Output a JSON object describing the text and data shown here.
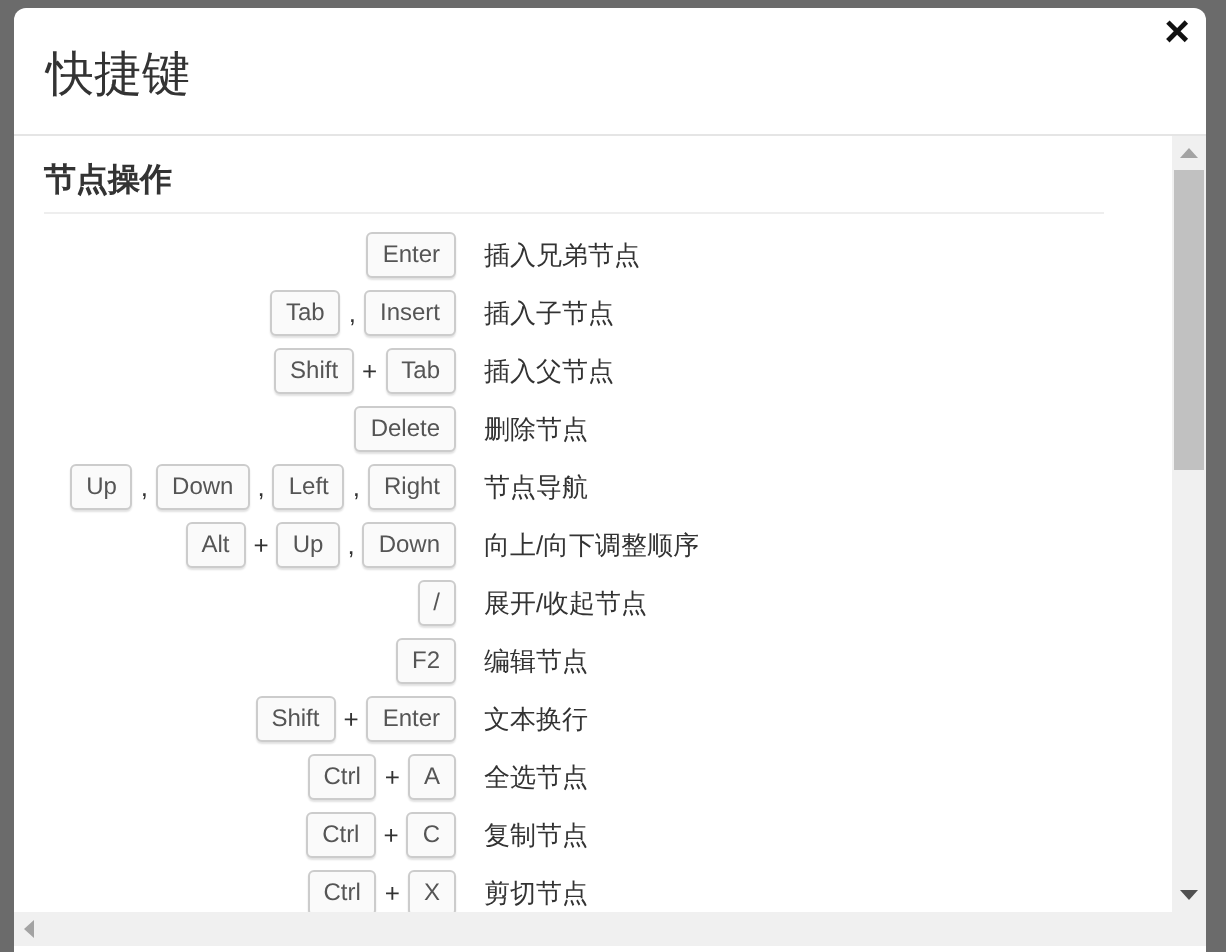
{
  "dialog": {
    "title": "快捷键",
    "close": "×"
  },
  "section": {
    "title": "节点操作"
  },
  "shortcuts": [
    {
      "combo": [
        {
          "kind": "key",
          "label": "Enter"
        }
      ],
      "action": "插入兄弟节点"
    },
    {
      "combo": [
        {
          "kind": "key",
          "label": "Tab"
        },
        {
          "kind": "sep",
          "label": ","
        },
        {
          "kind": "key",
          "label": "Insert"
        }
      ],
      "action": "插入子节点"
    },
    {
      "combo": [
        {
          "kind": "key",
          "label": "Shift"
        },
        {
          "kind": "sep",
          "label": "+"
        },
        {
          "kind": "key",
          "label": "Tab"
        }
      ],
      "action": "插入父节点"
    },
    {
      "combo": [
        {
          "kind": "key",
          "label": "Delete"
        }
      ],
      "action": "删除节点"
    },
    {
      "combo": [
        {
          "kind": "key",
          "label": "Up"
        },
        {
          "kind": "sep",
          "label": ","
        },
        {
          "kind": "key",
          "label": "Down"
        },
        {
          "kind": "sep",
          "label": ","
        },
        {
          "kind": "key",
          "label": "Left"
        },
        {
          "kind": "sep",
          "label": ","
        },
        {
          "kind": "key",
          "label": "Right"
        }
      ],
      "action": "节点导航"
    },
    {
      "combo": [
        {
          "kind": "key",
          "label": "Alt"
        },
        {
          "kind": "sep",
          "label": "+"
        },
        {
          "kind": "key",
          "label": "Up"
        },
        {
          "kind": "sep",
          "label": ","
        },
        {
          "kind": "key",
          "label": "Down"
        }
      ],
      "action": "向上/向下调整顺序"
    },
    {
      "combo": [
        {
          "kind": "key",
          "label": "/"
        }
      ],
      "action": "展开/收起节点"
    },
    {
      "combo": [
        {
          "kind": "key",
          "label": "F2"
        }
      ],
      "action": "编辑节点"
    },
    {
      "combo": [
        {
          "kind": "key",
          "label": "Shift"
        },
        {
          "kind": "sep",
          "label": "+"
        },
        {
          "kind": "key",
          "label": "Enter"
        }
      ],
      "action": "文本换行"
    },
    {
      "combo": [
        {
          "kind": "key",
          "label": "Ctrl"
        },
        {
          "kind": "sep",
          "label": "+"
        },
        {
          "kind": "key",
          "label": "A"
        }
      ],
      "action": "全选节点"
    },
    {
      "combo": [
        {
          "kind": "key",
          "label": "Ctrl"
        },
        {
          "kind": "sep",
          "label": "+"
        },
        {
          "kind": "key",
          "label": "C"
        }
      ],
      "action": "复制节点"
    },
    {
      "combo": [
        {
          "kind": "key",
          "label": "Ctrl"
        },
        {
          "kind": "sep",
          "label": "+"
        },
        {
          "kind": "key",
          "label": "X"
        }
      ],
      "action": "剪切节点"
    }
  ]
}
